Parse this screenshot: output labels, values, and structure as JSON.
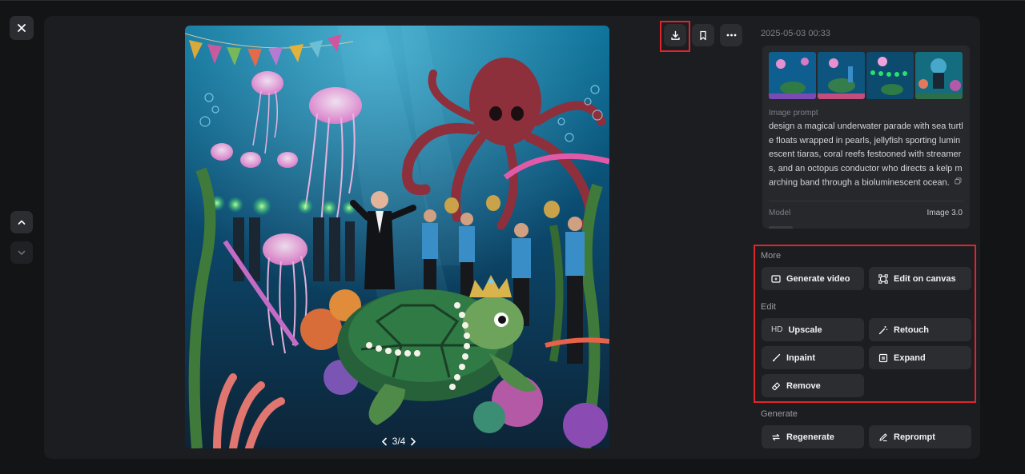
{
  "viewer": {
    "page_indicator": "3/4",
    "timestamp": "2025-05-03 00:33"
  },
  "info": {
    "prompt_label": "Image prompt",
    "prompt_text": "design a magical underwater parade with sea turtle floats wrapped in pearls, jellyfish sporting luminescent tiaras, coral reefs festooned with streamers, and an octopus conductor who directs a kelp marching band through a bioluminescent ocean.",
    "model_label": "Model",
    "model_value": "Image 3.0"
  },
  "sections": {
    "more": "More",
    "edit": "Edit",
    "generate": "Generate"
  },
  "actions": {
    "generate_video": "Generate video",
    "edit_on_canvas": "Edit on canvas",
    "upscale_prefix": "HD",
    "upscale": "Upscale",
    "retouch": "Retouch",
    "inpaint": "Inpaint",
    "expand": "Expand",
    "remove": "Remove",
    "regenerate": "Regenerate",
    "reprompt": "Reprompt"
  },
  "colors": {
    "background": "#131416",
    "panel": "#1c1d21",
    "button": "#2b2d31",
    "highlight": "#e0242b"
  },
  "icons": [
    "close-icon",
    "chevron-up-icon",
    "chevron-down-icon",
    "download-icon",
    "bookmark-icon",
    "more-horizontal-icon",
    "video-icon",
    "canvas-icon",
    "magic-wand-icon",
    "brush-icon",
    "expand-icon",
    "eraser-icon",
    "regenerate-icon",
    "pencil-icon",
    "copy-icon",
    "chevron-left-icon",
    "chevron-right-icon"
  ]
}
